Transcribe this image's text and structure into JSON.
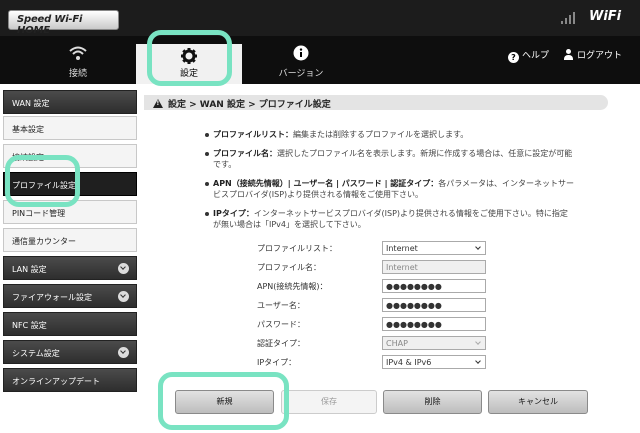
{
  "header": {
    "logo_text": "Speed Wi-Fi HOME",
    "wifi_badge": "WiFi"
  },
  "nav": {
    "tabs": [
      {
        "label": "接続"
      },
      {
        "label": "設定"
      },
      {
        "label": "バージョン"
      }
    ],
    "help": "ヘルプ",
    "logout": "ログアウト"
  },
  "sidebar": {
    "items": [
      {
        "label": "WAN 設定"
      },
      {
        "label": "基本設定"
      },
      {
        "label": "接続設定"
      },
      {
        "label": "プロファイル設定"
      },
      {
        "label": "PINコード管理"
      },
      {
        "label": "通信量カウンター"
      },
      {
        "label": "LAN 設定"
      },
      {
        "label": "ファイアウォール設定"
      },
      {
        "label": "NFC 設定"
      },
      {
        "label": "システム設定"
      },
      {
        "label": "オンラインアップデート"
      }
    ]
  },
  "breadcrumb": "設定 > WAN 設定 > プロファイル設定",
  "notes": [
    {
      "term": "プロファイルリスト：",
      "text": "編集または削除するプロファイルを選択します。"
    },
    {
      "term": "プロファイル名：",
      "text": "選択したプロファイル名を表示します。新規に作成する場合は、任意に設定が可能です。"
    },
    {
      "term": "APN（接続先情報）| ユーザー名 | パスワード | 認証タイプ：",
      "text": "各パラメータは、インターネットサービスプロバイダ(ISP)より提供される情報をご使用下さい。"
    },
    {
      "term": "IPタイプ：",
      "text": "インターネットサービスプロバイダ(ISP)より提供される情報をご使用下さい。特に指定が無い場合は「IPv4」を選択して下さい。"
    }
  ],
  "form": {
    "profile_list": {
      "label": "プロファイルリスト：",
      "value": "Internet"
    },
    "profile_name": {
      "label": "プロファイル名：",
      "value": "Internet"
    },
    "apn": {
      "label": "APN(接続先情報)：",
      "value": "●●●●●●●●"
    },
    "username": {
      "label": "ユーザー名：",
      "value": "●●●●●●●●"
    },
    "password": {
      "label": "パスワード：",
      "value": "●●●●●●●●"
    },
    "auth_type": {
      "label": "認証タイプ：",
      "value": "CHAP"
    },
    "ip_type": {
      "label": "IPタイプ：",
      "value": "IPv4 & IPv6"
    }
  },
  "buttons": {
    "new": "新規",
    "save": "保存",
    "delete": "削除",
    "cancel": "キャンセル"
  },
  "colors": {
    "highlight": "#79e3c2",
    "nav_bg": "#0e0e0e",
    "wifi_accent": "#9fd000"
  }
}
